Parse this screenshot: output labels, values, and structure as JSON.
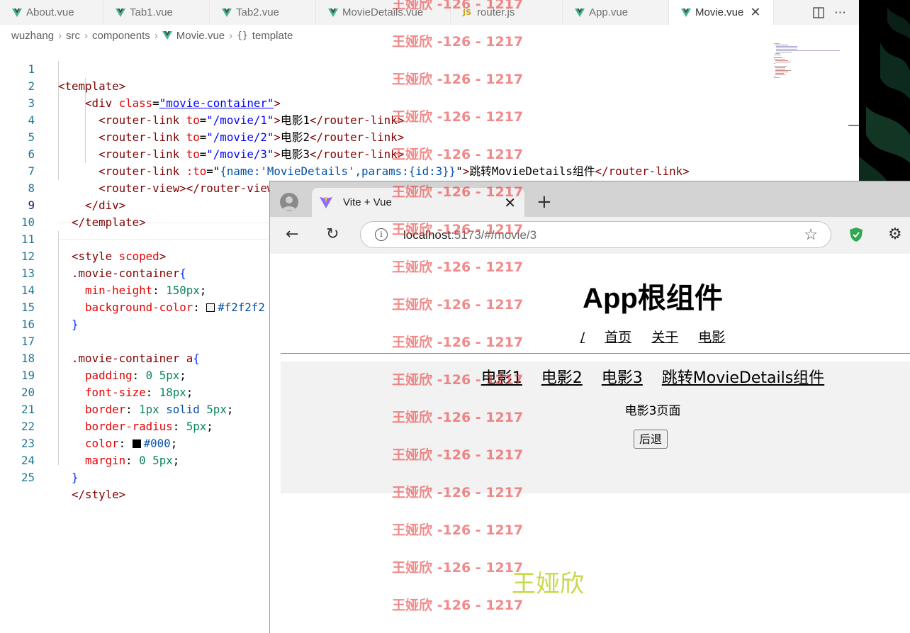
{
  "editor": {
    "tabs": [
      {
        "label": "About.vue",
        "icon": "vue-icon"
      },
      {
        "label": "Tab1.vue",
        "icon": "vue-icon"
      },
      {
        "label": "Tab2.vue",
        "icon": "vue-icon"
      },
      {
        "label": "MovieDetails.vue",
        "icon": "vue-icon"
      },
      {
        "label": "router.js",
        "icon": "js-icon"
      },
      {
        "label": "App.vue",
        "icon": "vue-icon"
      },
      {
        "label": "Movie.vue",
        "icon": "vue-icon",
        "active": true
      }
    ],
    "breadcrumb": [
      "wuzhang",
      "src",
      "components",
      "Movie.vue",
      "template"
    ],
    "line_numbers": [
      "1",
      "2",
      "3",
      "4",
      "5",
      "6",
      "7",
      "8",
      "9",
      "10",
      "11",
      "12",
      "13",
      "14",
      "15",
      "16",
      "17",
      "18",
      "19",
      "20",
      "21",
      "22",
      "23",
      "24",
      "25"
    ],
    "current_line": "9",
    "code": {
      "l1_open": "<template>",
      "l2_div": "<div",
      "l2_class": "class",
      "l2_val": "\"movie-container\"",
      "l2_gt": ">",
      "l3_tag": "<router-link",
      "l3_attr": "to",
      "l3_val": "\"/movie/1\"",
      "l3_text": "电影1",
      "l3_close": "</router-link>",
      "l4_val": "\"/movie/2\"",
      "l4_text": "电影2",
      "l5_val": "\"/movie/3\"",
      "l5_text": "电影3",
      "l6_attr": ":to",
      "l6_val": "{name:'MovieDetails',params:{id:3}}",
      "l6_text": "跳转MovieDetails组件",
      "l7": "<router-view></router-view>",
      "l8": "</div>",
      "l9": "</template>",
      "l11_tag": "<style",
      "l11_attr": "scoped",
      "l12_sel": ".movie-container",
      "l13_prop": "min-height",
      "l13_val": "150px",
      "l14_prop": "background-color",
      "l14_val": "#f2f2f2",
      "l17_sel": ".movie-container a",
      "l18_prop": "padding",
      "l18_val": "0 5px",
      "l19_prop": "font-size",
      "l19_val": "18px",
      "l20_prop": "border",
      "l20_val_num": "1px",
      "l20_val_kw": "solid",
      "l20_val_num2": "5px",
      "l21_prop": "border-radius",
      "l21_val": "5px",
      "l22_prop": "color",
      "l22_val": "#000",
      "l23_prop": "margin",
      "l23_val": "0 5px",
      "l25": "</style>"
    }
  },
  "browser": {
    "tab_title": "Vite + Vue",
    "url_host": "localhost",
    "url_path": ":5173/#/movie/3",
    "page": {
      "title": "App根组件",
      "nav": [
        "/",
        "首页",
        "关于",
        "电影"
      ],
      "movie_links": [
        "电影1",
        "电影2",
        "电影3",
        "跳转MovieDetails组件"
      ],
      "movie_page_text": "电影3页面",
      "back_button": "后退"
    }
  },
  "watermark": {
    "text": "王娅欣 -126 - 1217",
    "big_text": "王娅欣"
  },
  "colors": {
    "tag": "#800000",
    "attr": "#e50000",
    "string": "#0000ff",
    "number": "#098658",
    "line_number": "#237893",
    "watermark": "#e83c3c",
    "watermark_big": "#c8d84a",
    "movie_box_bg": "#f2f2f2"
  }
}
